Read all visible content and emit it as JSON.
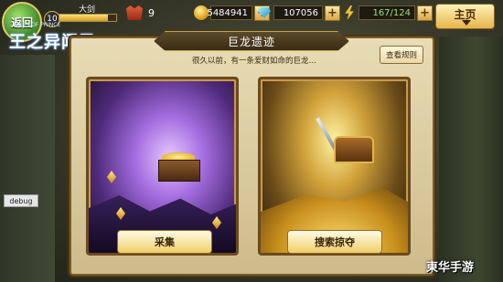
{
  "topbar": {
    "back_label": "返回",
    "player_level": "10",
    "player_name": "大剑",
    "xp_progress": 0.85,
    "rank_value": "9",
    "gold": "5484941",
    "gems": "107056",
    "stamina": "167/124",
    "plus_glyph": "+",
    "home_label": "主页"
  },
  "logo": {
    "title": "王之异闻录",
    "subtitle": "TALES OF PRINCE"
  },
  "dialog": {
    "title": "巨龙遗迹",
    "subtitle": "很久以前，有一条爱财如命的巨龙…",
    "rules_label": "查看规则"
  },
  "cards": {
    "collect_label": "采集",
    "search_label": "搜索掠夺"
  },
  "debug_label": "debug",
  "watermark": "東华手游",
  "colors": {
    "panel_bg": "#e8dcb6",
    "accent_gold": "#f0cf6a",
    "stamina_green": "#9be27a"
  }
}
